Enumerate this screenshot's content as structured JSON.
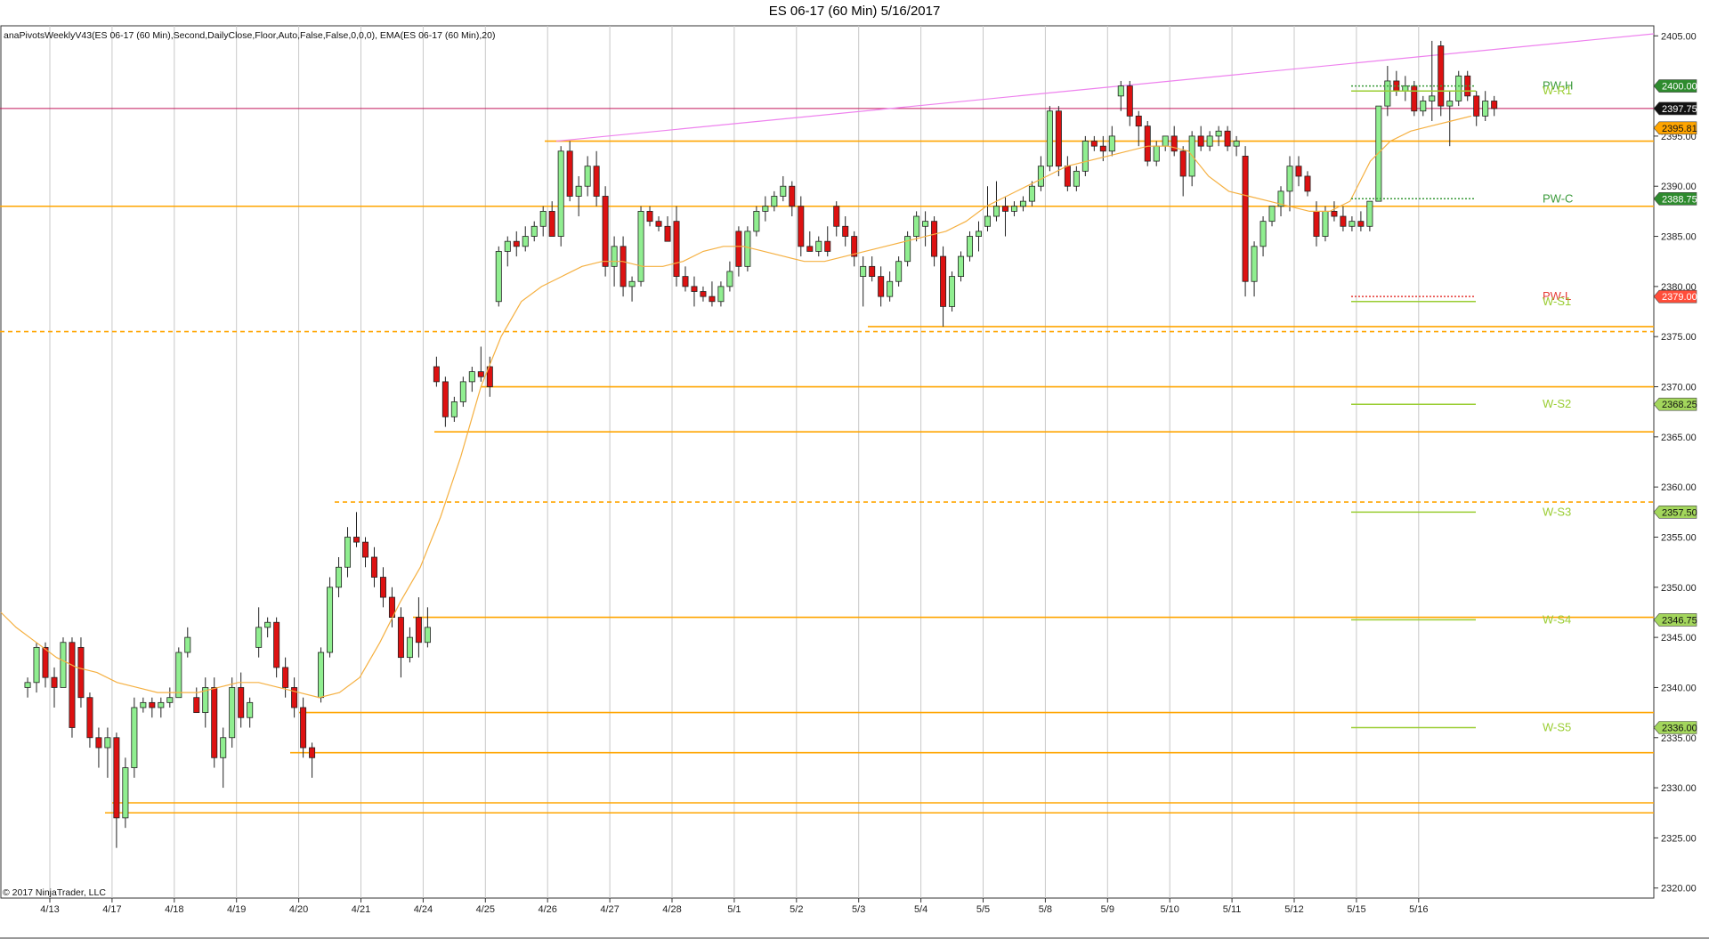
{
  "title": "ES 06-17 (60 Min)  5/16/2017",
  "indicator_label": "anaPivotsWeeklyV43(ES 06-17 (60 Min),Second,DailyClose,Floor,Auto,False,False,0,0,0), EMA(ES 06-17 (60 Min),20)",
  "copyright": "© 2017 NinjaTrader, LLC",
  "colors": {
    "up_candle": "#90ee90",
    "down_candle": "#dd1111",
    "candle_outline": "#222222",
    "grid": "#c8c8c8",
    "orange_line": "#ffa500",
    "ema": "#f5b041",
    "trend_line": "#ee82ee",
    "red_line": "#c2185b",
    "pivot_green": "#3a9a3a",
    "pivot_light_green": "#9acd32",
    "pivot_red": "#e53935"
  },
  "chart_data": {
    "type": "candlestick",
    "symbol": "ES 06-17",
    "interval": "60 Min",
    "ylim": [
      2319,
      2406
    ],
    "y_ticks": [
      2320,
      2325,
      2330,
      2335,
      2340,
      2345,
      2350,
      2355,
      2360,
      2365,
      2370,
      2375,
      2380,
      2385,
      2390,
      2395,
      2400,
      2405
    ],
    "y_tick_labels": [
      "2320.00",
      "2325.00",
      "2330.00",
      "2335.00",
      "2340.00",
      "2345.00",
      "2350.00",
      "2355.00",
      "2360.00",
      "2365.00",
      "2370.00",
      "2375.00",
      "2380.00",
      "2385.00",
      "2390.00",
      "2395.00",
      "2400.00",
      "2405.00"
    ],
    "x_ticks": [
      "4/13",
      "4/17",
      "4/18",
      "4/19",
      "4/20",
      "4/21",
      "4/24",
      "4/25",
      "4/26",
      "4/27",
      "4/28",
      "5/1",
      "5/2",
      "5/3",
      "5/4",
      "5/5",
      "5/8",
      "5/9",
      "5/10",
      "5/11",
      "5/12",
      "5/15",
      "5/16"
    ],
    "bars_per_day": 7,
    "start_offset": 5,
    "bar_count": 152,
    "candles": [
      [
        2340.0,
        2341.0,
        2339.0,
        2340.5
      ],
      [
        2340.5,
        2344.5,
        2339.5,
        2344.0
      ],
      [
        2344.0,
        2344.5,
        2340.0,
        2341.0
      ],
      [
        2341.0,
        2342.0,
        2338.0,
        2340.0
      ],
      [
        2340.0,
        2345.0,
        2340.0,
        2344.5
      ],
      [
        2344.5,
        2345.0,
        2335.0,
        2336.0
      ],
      [
        2344.0,
        2345.0,
        2338.0,
        2339.0
      ],
      [
        2339.0,
        2339.5,
        2334.0,
        2335.0
      ],
      [
        2335.0,
        2336.0,
        2332.0,
        2334.0
      ],
      [
        2334.0,
        2336.0,
        2331.0,
        2335.0
      ],
      [
        2335.0,
        2335.5,
        2324.0,
        2327.0
      ],
      [
        2327.0,
        2333.0,
        2326.0,
        2332.0
      ],
      [
        2332.0,
        2339.0,
        2331.0,
        2338.0
      ],
      [
        2338.0,
        2339.0,
        2337.5,
        2338.5
      ],
      [
        2338.5,
        2339.0,
        2337.0,
        2338.0
      ],
      [
        2338.0,
        2339.0,
        2337.0,
        2338.5
      ],
      [
        2338.5,
        2340.0,
        2338.0,
        2339.0
      ],
      [
        2339.0,
        2344.0,
        2339.0,
        2343.5
      ],
      [
        2343.5,
        2346.0,
        2343.0,
        2345.0
      ],
      [
        2339.0,
        2340.0,
        2338.0,
        2337.5
      ],
      [
        2337.5,
        2341.0,
        2336.0,
        2340.0
      ],
      [
        2340.0,
        2341.0,
        2332.0,
        2333.0
      ],
      [
        2333.0,
        2336.0,
        2330.0,
        2335.0
      ],
      [
        2335.0,
        2341.0,
        2334.0,
        2340.0
      ],
      [
        2340.0,
        2341.5,
        2336.0,
        2337.0
      ],
      [
        2337.0,
        2339.0,
        2336.0,
        2338.5
      ],
      [
        2344.0,
        2348.0,
        2343.0,
        2346.0
      ],
      [
        2346.0,
        2347.0,
        2345.0,
        2346.5
      ],
      [
        2346.5,
        2347.0,
        2341.0,
        2342.0
      ],
      [
        2342.0,
        2343.0,
        2339.0,
        2340.0
      ],
      [
        2340.0,
        2341.0,
        2337.0,
        2338.0
      ],
      [
        2338.0,
        2339.0,
        2333.0,
        2334.0
      ],
      [
        2334.0,
        2334.5,
        2331.0,
        2333.0
      ],
      [
        2339.0,
        2344.0,
        2338.5,
        2343.5
      ],
      [
        2343.5,
        2351.0,
        2343.0,
        2350.0
      ],
      [
        2350.0,
        2353.0,
        2349.0,
        2352.0
      ],
      [
        2352.0,
        2356.0,
        2351.0,
        2355.0
      ],
      [
        2355.0,
        2357.5,
        2354.0,
        2354.5
      ],
      [
        2354.5,
        2355.0,
        2352.0,
        2353.0
      ],
      [
        2353.0,
        2354.0,
        2350.0,
        2351.0
      ],
      [
        2351.0,
        2352.0,
        2348.0,
        2349.0
      ],
      [
        2349.0,
        2350.0,
        2346.0,
        2347.0
      ],
      [
        2347.0,
        2348.0,
        2341.0,
        2343.0
      ],
      [
        2343.0,
        2346.0,
        2342.5,
        2345.0
      ],
      [
        2347.0,
        2349.0,
        2343.0,
        2344.5
      ],
      [
        2344.5,
        2348.0,
        2344.0,
        2346.0
      ],
      [
        2372.0,
        2373.0,
        2370.0,
        2370.5
      ],
      [
        2370.5,
        2371.0,
        2366.0,
        2367.0
      ],
      [
        2367.0,
        2369.0,
        2366.5,
        2368.5
      ],
      [
        2368.5,
        2371.0,
        2368.0,
        2370.5
      ],
      [
        2370.5,
        2372.0,
        2369.5,
        2371.5
      ],
      [
        2371.5,
        2374.0,
        2370.5,
        2371.0
      ],
      [
        2372.0,
        2373.0,
        2369.0,
        2370.0
      ],
      [
        2378.5,
        2384.0,
        2378.0,
        2383.5
      ],
      [
        2383.5,
        2385.0,
        2382.0,
        2384.5
      ],
      [
        2384.5,
        2385.5,
        2383.0,
        2384.0
      ],
      [
        2384.0,
        2386.0,
        2383.5,
        2385.0
      ],
      [
        2385.0,
        2386.5,
        2384.5,
        2386.0
      ],
      [
        2386.0,
        2388.0,
        2385.0,
        2387.5
      ],
      [
        2387.5,
        2388.5,
        2386.0,
        2385.0
      ],
      [
        2385.0,
        2394.0,
        2384.0,
        2393.5
      ],
      [
        2393.5,
        2394.5,
        2388.5,
        2389.0
      ],
      [
        2389.0,
        2391.0,
        2387.0,
        2390.0
      ],
      [
        2390.0,
        2393.0,
        2389.0,
        2392.0
      ],
      [
        2392.0,
        2393.5,
        2388.0,
        2389.0
      ],
      [
        2389.0,
        2390.0,
        2381.0,
        2382.0
      ],
      [
        2382.0,
        2385.0,
        2380.0,
        2384.0
      ],
      [
        2384.0,
        2385.0,
        2379.0,
        2380.0
      ],
      [
        2380.0,
        2381.0,
        2378.5,
        2380.5
      ],
      [
        2380.5,
        2388.0,
        2380.0,
        2387.5
      ],
      [
        2387.5,
        2388.0,
        2386.0,
        2386.5
      ],
      [
        2386.5,
        2387.0,
        2385.5,
        2386.0
      ],
      [
        2386.0,
        2387.0,
        2385.0,
        2384.5
      ],
      [
        2386.5,
        2388.0,
        2380.0,
        2381.0
      ],
      [
        2381.0,
        2382.0,
        2379.5,
        2380.0
      ],
      [
        2380.0,
        2381.0,
        2378.0,
        2379.5
      ],
      [
        2379.5,
        2380.0,
        2378.5,
        2379.0
      ],
      [
        2379.0,
        2380.5,
        2378.0,
        2378.5
      ],
      [
        2378.5,
        2380.5,
        2378.0,
        2380.0
      ],
      [
        2380.0,
        2382.5,
        2379.5,
        2381.5
      ],
      [
        2385.5,
        2386.0,
        2381.0,
        2382.0
      ],
      [
        2382.0,
        2386.0,
        2381.5,
        2385.5
      ],
      [
        2385.5,
        2388.0,
        2385.0,
        2387.5
      ],
      [
        2387.5,
        2389.0,
        2386.5,
        2388.0
      ],
      [
        2388.0,
        2389.5,
        2387.5,
        2389.0
      ],
      [
        2389.0,
        2391.0,
        2388.5,
        2390.0
      ],
      [
        2390.0,
        2390.5,
        2387.0,
        2388.0
      ],
      [
        2388.0,
        2389.0,
        2383.0,
        2384.0
      ],
      [
        2384.0,
        2385.5,
        2383.5,
        2383.5
      ],
      [
        2383.5,
        2385.0,
        2383.0,
        2384.5
      ],
      [
        2384.5,
        2386.0,
        2383.0,
        2383.5
      ],
      [
        2388.0,
        2388.5,
        2385.0,
        2386.0
      ],
      [
        2386.0,
        2387.0,
        2384.0,
        2385.0
      ],
      [
        2385.0,
        2385.5,
        2382.0,
        2383.0
      ],
      [
        2381.0,
        2383.0,
        2378.0,
        2382.0
      ],
      [
        2382.0,
        2383.0,
        2380.5,
        2381.0
      ],
      [
        2381.0,
        2382.0,
        2378.0,
        2379.0
      ],
      [
        2379.0,
        2381.5,
        2378.5,
        2380.5
      ],
      [
        2380.5,
        2383.0,
        2380.0,
        2382.5
      ],
      [
        2382.5,
        2385.5,
        2382.0,
        2385.0
      ],
      [
        2385.0,
        2387.5,
        2384.5,
        2387.0
      ],
      [
        2386.0,
        2387.5,
        2384.0,
        2386.5
      ],
      [
        2386.5,
        2387.0,
        2382.0,
        2383.0
      ],
      [
        2383.0,
        2384.0,
        2376.0,
        2378.0
      ],
      [
        2378.0,
        2381.5,
        2377.5,
        2381.0
      ],
      [
        2381.0,
        2383.5,
        2380.5,
        2383.0
      ],
      [
        2383.0,
        2385.5,
        2382.5,
        2385.0
      ],
      [
        2385.0,
        2386.5,
        2383.5,
        2385.5
      ],
      [
        2386.0,
        2390.0,
        2385.5,
        2387.0
      ],
      [
        2387.0,
        2390.5,
        2386.5,
        2388.0
      ],
      [
        2388.0,
        2389.0,
        2385.0,
        2387.5
      ],
      [
        2387.5,
        2388.5,
        2387.0,
        2388.0
      ],
      [
        2388.0,
        2389.0,
        2387.5,
        2388.5
      ],
      [
        2388.5,
        2390.5,
        2388.0,
        2390.0
      ],
      [
        2390.0,
        2393.0,
        2389.5,
        2392.0
      ],
      [
        2392.0,
        2398.0,
        2391.5,
        2397.5
      ],
      [
        2397.5,
        2398.0,
        2391.0,
        2392.0
      ],
      [
        2392.0,
        2393.0,
        2389.5,
        2390.0
      ],
      [
        2390.0,
        2392.0,
        2389.5,
        2391.5
      ],
      [
        2391.5,
        2395.0,
        2391.0,
        2394.5
      ],
      [
        2394.5,
        2395.0,
        2393.5,
        2394.0
      ],
      [
        2394.0,
        2395.0,
        2392.5,
        2393.5
      ],
      [
        2393.5,
        2396.0,
        2393.0,
        2395.0
      ],
      [
        2399.0,
        2400.5,
        2397.5,
        2400.0
      ],
      [
        2400.0,
        2400.5,
        2396.0,
        2397.0
      ],
      [
        2397.0,
        2397.5,
        2394.0,
        2396.0
      ],
      [
        2396.0,
        2396.5,
        2392.0,
        2392.5
      ],
      [
        2392.5,
        2394.5,
        2392.0,
        2394.0
      ],
      [
        2394.0,
        2395.0,
        2393.5,
        2395.0
      ],
      [
        2395.0,
        2396.0,
        2393.0,
        2393.5
      ],
      [
        2393.5,
        2394.0,
        2389.0,
        2391.0
      ],
      [
        2391.0,
        2395.5,
        2390.0,
        2395.0
      ],
      [
        2395.0,
        2396.0,
        2393.5,
        2394.0
      ],
      [
        2394.0,
        2395.5,
        2393.5,
        2395.0
      ],
      [
        2395.0,
        2396.0,
        2394.0,
        2395.5
      ],
      [
        2395.5,
        2396.0,
        2393.5,
        2394.0
      ],
      [
        2394.0,
        2395.0,
        2393.0,
        2394.5
      ],
      [
        2393.0,
        2394.0,
        2379.0,
        2380.5
      ],
      [
        2380.5,
        2384.5,
        2379.0,
        2384.0
      ],
      [
        2384.0,
        2387.0,
        2383.0,
        2386.5
      ],
      [
        2386.5,
        2388.0,
        2386.0,
        2388.0
      ],
      [
        2388.0,
        2390.0,
        2387.0,
        2389.5
      ],
      [
        2389.5,
        2393.0,
        2387.5,
        2392.0
      ],
      [
        2392.0,
        2393.0,
        2390.0,
        2391.0
      ],
      [
        2391.0,
        2391.5,
        2389.0,
        2389.5
      ],
      [
        2387.5,
        2388.5,
        2384.0,
        2385.0
      ],
      [
        2385.0,
        2388.0,
        2384.5,
        2387.5
      ],
      [
        2387.5,
        2388.5,
        2386.5,
        2387.0
      ],
      [
        2387.0,
        2388.0,
        2385.5,
        2386.0
      ],
      [
        2386.0,
        2387.0,
        2385.5,
        2386.5
      ],
      [
        2386.5,
        2387.5,
        2385.5,
        2386.0
      ],
      [
        2386.0,
        2388.5,
        2385.5,
        2388.5
      ]
    ],
    "candles_5_15": [
      [
        2388.5,
        2393.0,
        2392.0,
        2398.0
      ],
      [
        2398.0,
        2402.0,
        2397.0,
        2400.5
      ],
      [
        2400.5,
        2401.5,
        2399.0,
        2399.5
      ],
      [
        2399.5,
        2401.0,
        2398.5,
        2400.0
      ],
      [
        2400.0,
        2400.5,
        2397.0,
        2397.5
      ],
      [
        2397.5,
        2399.0,
        2397.0,
        2398.5
      ],
      [
        2398.5,
        2404.5,
        2396.5,
        2399.0
      ]
    ],
    "candles_5_16": [
      [
        2404.0,
        2404.5,
        2397.0,
        2398.0
      ],
      [
        2398.0,
        2399.5,
        2394.0,
        2398.5
      ],
      [
        2398.5,
        2401.5,
        2398.0,
        2401.0
      ],
      [
        2401.0,
        2401.5,
        2398.5,
        2399.0
      ],
      [
        2399.0,
        2399.5,
        2396.0,
        2397.0
      ],
      [
        2397.0,
        2399.5,
        2396.5,
        2398.5
      ],
      [
        2398.5,
        2399.0,
        2397.0,
        2397.75
      ]
    ],
    "ema_values": [
      2347.5,
      2346.0,
      2344.5,
      2343.0,
      2342.0,
      2341.5,
      2340.5,
      2340.0,
      2339.5,
      2339.5,
      2339.5,
      2340.0,
      2340.5,
      2340.5,
      2340.0,
      2339.5,
      2339.0,
      2339.5,
      2341.0,
      2344.5,
      2348.5,
      2352.0,
      2357.0,
      2363.0,
      2370.0,
      2375.0,
      2378.5,
      2380.0,
      2381.0,
      2382.0,
      2382.5,
      2382.5,
      2382.0,
      2382.0,
      2382.5,
      2383.5,
      2384.0,
      2384.0,
      2383.5,
      2383.0,
      2382.5,
      2382.5,
      2383.0,
      2383.5,
      2384.0,
      2384.5,
      2385.0,
      2385.5,
      2386.5,
      2388.0,
      2389.0,
      2390.0,
      2391.0,
      2392.0,
      2392.5,
      2393.0,
      2393.5,
      2394.0,
      2394.0,
      2393.5,
      2391.0,
      2389.5,
      2389.0,
      2388.5,
      2388.0,
      2387.5,
      2387.5,
      2388.5,
      2392.5,
      2394.5,
      2395.5,
      2396.0,
      2396.5,
      2397.0
    ],
    "ema_positions": [
      0,
      3,
      7,
      11,
      15,
      19,
      23,
      27,
      31,
      35,
      39,
      43,
      47,
      51,
      55,
      59,
      63,
      67,
      71,
      75,
      79,
      83,
      87,
      91,
      95,
      99,
      103,
      107,
      111,
      115,
      119,
      123,
      127,
      131,
      135,
      139,
      143,
      147,
      151,
      155,
      159,
      163,
      167,
      171,
      175,
      179,
      183,
      187,
      191,
      195,
      199,
      203,
      207,
      211,
      215,
      219,
      223,
      227,
      231,
      235,
      239,
      243,
      247,
      251,
      255,
      259,
      263,
      267,
      271,
      275,
      279,
      283,
      287,
      291
    ],
    "horizontal_levels": [
      {
        "price": 2397.75,
        "color": "red",
        "label": "2397.75"
      },
      {
        "price": 2394.5,
        "color": "orange"
      },
      {
        "price": 2388.0,
        "color": "orange"
      },
      {
        "price": 2375.5,
        "color": "orange",
        "style": "dashed"
      },
      {
        "price": 2376.0,
        "color": "orange"
      },
      {
        "price": 2370.0,
        "color": "orange"
      },
      {
        "price": 2365.5,
        "color": "orange"
      },
      {
        "price": 2358.5,
        "color": "orange",
        "style": "dashed"
      },
      {
        "price": 2347.0,
        "color": "orange"
      },
      {
        "price": 2337.5,
        "color": "orange"
      },
      {
        "price": 2333.5,
        "color": "orange"
      },
      {
        "price": 2328.5,
        "color": "orange"
      },
      {
        "price": 2327.5,
        "color": "orange"
      }
    ],
    "pivot_levels": [
      {
        "name": "PW-H",
        "price": 2400.0,
        "tag": "2400.00",
        "color": "green"
      },
      {
        "name": "W-R1",
        "price": 2399.5,
        "tag": "",
        "color": "lightgreen"
      },
      {
        "name": "PW-C",
        "price": 2388.75,
        "tag": "2388.75",
        "color": "green"
      },
      {
        "name": "PW-L",
        "price": 2379.0,
        "tag": "2379.00",
        "color": "red"
      },
      {
        "name": "W-S1",
        "price": 2378.5,
        "tag": "",
        "color": "lightgreen"
      },
      {
        "name": "W-S2",
        "price": 2368.25,
        "tag": "2368.25",
        "color": "lightgreen"
      },
      {
        "name": "W-S3",
        "price": 2357.5,
        "tag": "2357.50",
        "color": "lightgreen"
      },
      {
        "name": "W-S4",
        "price": 2346.75,
        "tag": "2346.75",
        "color": "lightgreen"
      },
      {
        "name": "W-S5",
        "price": 2336.0,
        "tag": "2336.00",
        "color": "lightgreen"
      }
    ],
    "last_price_tags": [
      {
        "price": 2397.75,
        "tag": "2397.75",
        "color": "black"
      },
      {
        "price": 2395.81,
        "tag": "2395.81",
        "color": "orange"
      }
    ]
  }
}
